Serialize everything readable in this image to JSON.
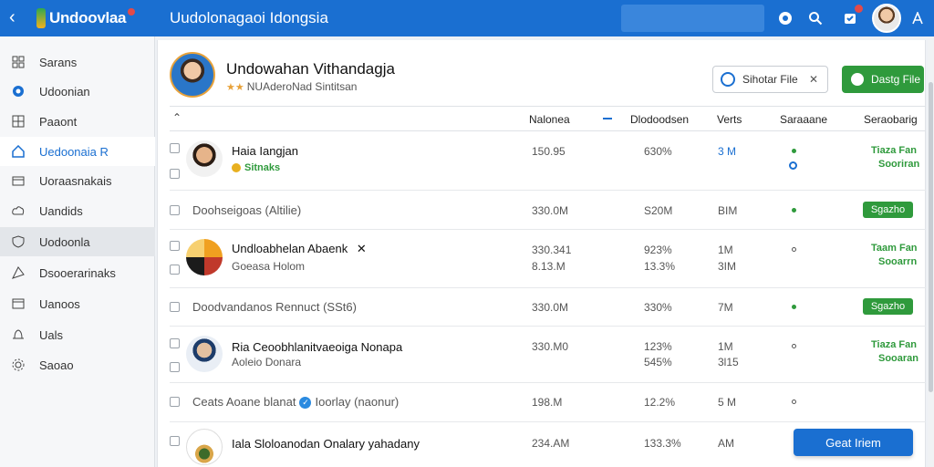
{
  "topbar": {
    "back_icon": "chevron-left-icon",
    "logo_text": "Undoovlaa",
    "title": "Uudolonagaoi Idongsia",
    "icons": [
      "help-icon",
      "search-icon",
      "notification-icon",
      "user-icon"
    ]
  },
  "sidebar": {
    "items": [
      {
        "label": "Sarans",
        "icon": "grid-icon"
      },
      {
        "label": "Udoonian",
        "icon": "circle-icon"
      },
      {
        "label": "Paaont",
        "icon": "table-icon"
      },
      {
        "label": "Uedoonaia R",
        "icon": "home-icon"
      },
      {
        "label": "Uoraasnakais",
        "icon": "card-icon"
      },
      {
        "label": "Uandids",
        "icon": "cloud-icon"
      },
      {
        "label": "Uodoonla",
        "icon": "shield-icon"
      },
      {
        "label": "Dsooerarinaks",
        "icon": "tag-icon"
      },
      {
        "label": "Uanoos",
        "icon": "box-icon"
      },
      {
        "label": "Uals",
        "icon": "bell-icon"
      },
      {
        "label": "Saoao",
        "icon": "settings-icon"
      }
    ]
  },
  "profile": {
    "name": "Undowahan Vithandagja",
    "subtitle": "NUAderoNad Sintitsan",
    "outline_button": "Sihotar File",
    "green_button": "Dastg File"
  },
  "table": {
    "headers": [
      "Nalonea",
      "Dlodoodsen",
      "Verts",
      "Saraaane",
      "Seraobarig"
    ],
    "rows": [
      {
        "title": "Haia Iangjan",
        "sub": "Sitnaks",
        "c1": "150.95",
        "c2": "630%",
        "c3": "3 M",
        "s1": "Tiaza Fan",
        "s2": "Sooriran"
      },
      {
        "title": "Doohseigoas (Altilie)",
        "c1": "330.0M",
        "c2": "S20M",
        "c3": "BIM",
        "chip": "Sgazho"
      },
      {
        "title": "Undloabhelan Abaenk",
        "sub": "Goeasa Holom",
        "c1": "330.341",
        "c1b": "8.13.M",
        "c2": "923%",
        "c2b": "13.3%",
        "c3": "1M",
        "c3b": "3IM",
        "s1": "Taam Fan",
        "s2": "Sooarrn"
      },
      {
        "title": "Doodvandanos Rennuct (SSt6)",
        "c1": "330.0M",
        "c2": "330%",
        "c3": "7M",
        "chip": "Sgazho"
      },
      {
        "title": "Ria Ceoobhlanitvaeoiga Nonapa",
        "sub": "Aoleio Donara",
        "c1": "330.M0",
        "c2": "123%",
        "c2b": "545%",
        "c3": "1M",
        "c3b": "3l15",
        "s1": "Tiaza Fan",
        "s2": "Sooaran"
      },
      {
        "title": "Ceats Aoane blanat",
        "title2": "Ioorlay (naonur)",
        "c1": "198.M",
        "c2": "12.2%",
        "c3": "5 M"
      },
      {
        "title": "Iala Sloloanodan Onalary yahadany",
        "c1": "234.AM",
        "c2": "133.3%",
        "c3": "AM"
      }
    ]
  },
  "floating_button": "Geat Iriem"
}
